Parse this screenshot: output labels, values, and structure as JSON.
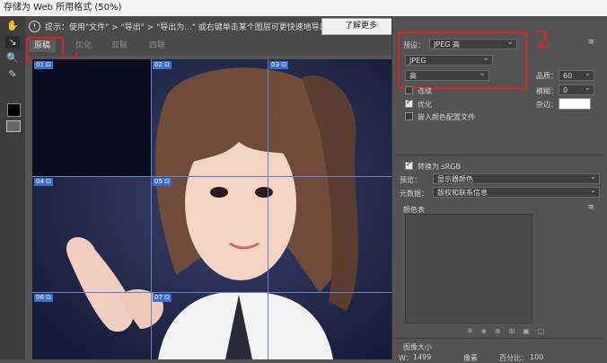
{
  "window": {
    "title": "存储为 Web 所用格式 (50%)"
  },
  "infobar": {
    "tip": "提示：使用\"文件\" > \"导出\" > \"导出为...\" 或右键单击某个图层可更快速地导出资源",
    "understand_button": "了解更多"
  },
  "tabs": [
    {
      "label": "原稿",
      "active": true
    },
    {
      "label": "优化",
      "active": false
    },
    {
      "label": "双联",
      "active": false
    },
    {
      "label": "四联",
      "active": false
    }
  ],
  "annotations": {
    "one": "/",
    "two": "2",
    "color": "#e02020"
  },
  "slices": [
    {
      "label": "01 ⊡"
    },
    {
      "label": "02 ⊡"
    },
    {
      "label": "03 ⊡"
    },
    {
      "label": "04 ⊡"
    },
    {
      "label": "05 ⊡"
    },
    {
      "label": "06 ⊡"
    },
    {
      "label": "07 ⊡"
    }
  ],
  "settings": {
    "preset_label": "预设：",
    "preset_value": "JPEG 高",
    "format_value": "JPEG",
    "quality_preset_value": "高",
    "quality_label": "品质：",
    "quality_value": "60",
    "blur_label": "模糊：",
    "blur_value": "0",
    "matte_label": "杂边：",
    "progressive_label": "连续",
    "optimized_label": "优化",
    "embed_profile_label": "嵌入颜色配置文件",
    "convert_srgb_label": "转换为 sRGB",
    "preview_label": "预览：",
    "preview_value": "显示器颜色",
    "metadata_label": "元数据：",
    "metadata_value": "版权和联系信息",
    "color_table_label": "颜色表",
    "image_size_label": "图像大小",
    "width_label": "W：",
    "width_value": "1499",
    "width_unit": "像素",
    "percent_label": "百分比：",
    "percent_value": "100"
  }
}
